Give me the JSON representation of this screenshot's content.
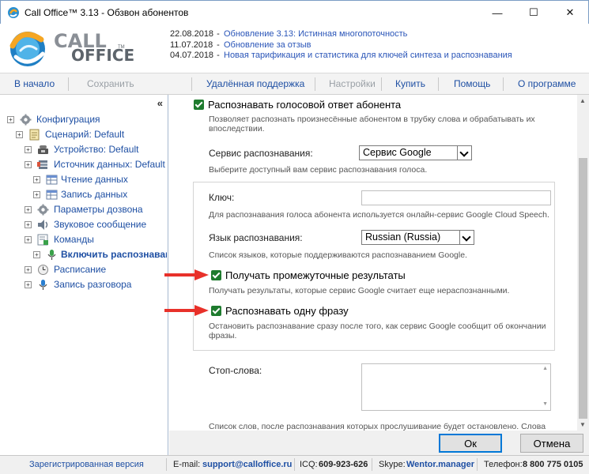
{
  "window": {
    "title": "Call Office™ 3.13 - Обзвон абонентов",
    "minimize_glyph": "—",
    "maximize_glyph": "☐",
    "close_glyph": "✕"
  },
  "logo": {
    "word1": "CALL",
    "word2": "OFFICE",
    "tm": "TM"
  },
  "news": [
    {
      "date": "22.08.2018",
      "dash": "-",
      "text": "Обновление 3.13: Истинная многопоточность"
    },
    {
      "date": "11.07.2018",
      "dash": "-",
      "text": "Обновление за отзыв"
    },
    {
      "date": "04.07.2018",
      "dash": "-",
      "text": "Новая тарификация и статистика для ключей синтеза и распознавания"
    }
  ],
  "toolbar": {
    "home": "В начало",
    "save": "Сохранить",
    "remote": "Удалённая поддержка",
    "settings": "Настройки",
    "buy": "Купить",
    "help": "Помощь",
    "about": "О программе"
  },
  "sidebar": {
    "collapse_glyph": "«",
    "tree": {
      "config": "Конфигурация",
      "scenario": "Сценарий: Default",
      "device": "Устройство: Default",
      "datasource": "Источник данных: Default",
      "read": "Чтение данных",
      "write": "Запись данных",
      "dial": "Параметры дозвона",
      "sound": "Звуковое сообщение",
      "commands": "Команды",
      "enable_recog": "Включить распознавание",
      "schedule": "Расписание",
      "recording": "Запись разговора"
    },
    "toggle_glyph": "+"
  },
  "content": {
    "recognize_voice": "Распознавать голосовой ответ абонента",
    "recognize_voice_hint1": "Позволяет распознать произнесённые абонентом в трубку слова и обрабатывать их",
    "recognize_voice_hint2": "впоследствии.",
    "service_label": "Сервис распознавания:",
    "service_value": "Сервис Google",
    "service_hint": "Выберите доступный вам сервис распознавания голоса.",
    "key_label": "Ключ:",
    "key_value": "",
    "key_hint": "Для распознавания голоса абонента используется онлайн-сервис Google Cloud Speech.",
    "lang_label": "Язык распознавания:",
    "lang_value": "Russian (Russia)",
    "lang_hint": "Список языков, которые поддерживаются распознаванием Google.",
    "interim": "Получать промежуточные результаты",
    "interim_hint": "Получать результаты, которые сервис Google считает еще нераспознанными.",
    "single": "Распознавать одну фразу",
    "single_hint1": "Остановить распознавание сразу после того, как сервис Google сообщит об окончании",
    "single_hint2": "фразы.",
    "stopwords_label": "Стоп-слова:",
    "stopwords_hint": "Список слов, после распознавания которых прослушивание будет остановлено. Слова"
  },
  "buttons": {
    "ok": "Ок",
    "cancel": "Отмена"
  },
  "statusbar": {
    "registered": "Зарегистрированная версия",
    "email_label": "E-mail:",
    "email": "support@calloffice.ru",
    "icq_label": "ICQ:",
    "icq": "609-923-626",
    "skype_label": "Skype:",
    "skype": "Wentor.manager",
    "phone_label": "Телефон:",
    "phone": "8 800 775 0105"
  },
  "colors": {
    "accent": "#1e4fa3",
    "checkbox": "#1e7b2e",
    "arrow": "#e8312a"
  }
}
